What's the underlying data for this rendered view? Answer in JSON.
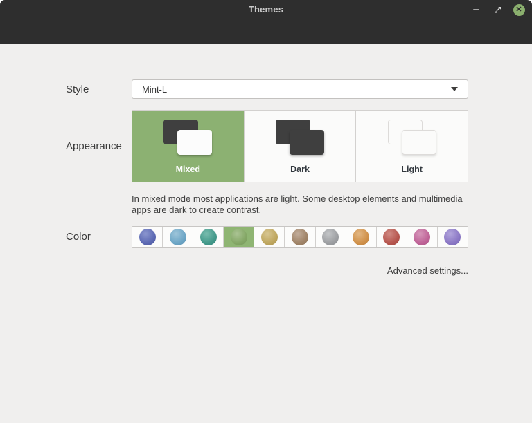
{
  "window": {
    "title": "Themes",
    "close_glyph": "✕"
  },
  "style": {
    "label": "Style",
    "value": "Mint-L"
  },
  "appearance": {
    "label": "Appearance",
    "options": [
      {
        "label": "Mixed",
        "selected": true
      },
      {
        "label": "Dark",
        "selected": false
      },
      {
        "label": "Light",
        "selected": false
      }
    ],
    "selected_bg": "#8cb172",
    "description": "In mixed mode most applications are light. Some desktop elements and multimedia apps are dark to create contrast."
  },
  "color": {
    "label": "Color",
    "selected_bg": "#8fb573",
    "swatches": [
      {
        "name": "blue",
        "hi": "#8b96cf",
        "base": "#5c69b3",
        "dark": "#4b569c",
        "selected": false
      },
      {
        "name": "aqua",
        "hi": "#9ec5da",
        "base": "#6da6c6",
        "dark": "#5a8fb0",
        "selected": false
      },
      {
        "name": "teal",
        "hi": "#79bcae",
        "base": "#43998a",
        "dark": "#35847a",
        "selected": false
      },
      {
        "name": "green",
        "hi": "#abc494",
        "base": "#84a766",
        "dark": "#74955a",
        "selected": true
      },
      {
        "name": "sand",
        "hi": "#d7c693",
        "base": "#bfa75f",
        "dark": "#a89150",
        "selected": false
      },
      {
        "name": "brown",
        "hi": "#c2ad9b",
        "base": "#a08468",
        "dark": "#8c7258",
        "selected": false
      },
      {
        "name": "grey",
        "hi": "#c4c6c8",
        "base": "#9d9fa2",
        "dark": "#898b8e",
        "selected": false
      },
      {
        "name": "orange",
        "hi": "#e2b783",
        "base": "#d0914a",
        "dark": "#b87e3e",
        "selected": false
      },
      {
        "name": "red",
        "hi": "#d08a83",
        "base": "#b6564e",
        "dark": "#9e4741",
        "selected": false
      },
      {
        "name": "pink",
        "hi": "#d697ba",
        "base": "#bf6397",
        "dark": "#a85384",
        "selected": false
      },
      {
        "name": "purple",
        "hi": "#b2a5dc",
        "base": "#8b78c5",
        "dark": "#7766b2",
        "selected": false
      }
    ]
  },
  "advanced": {
    "label": "Advanced settings..."
  }
}
